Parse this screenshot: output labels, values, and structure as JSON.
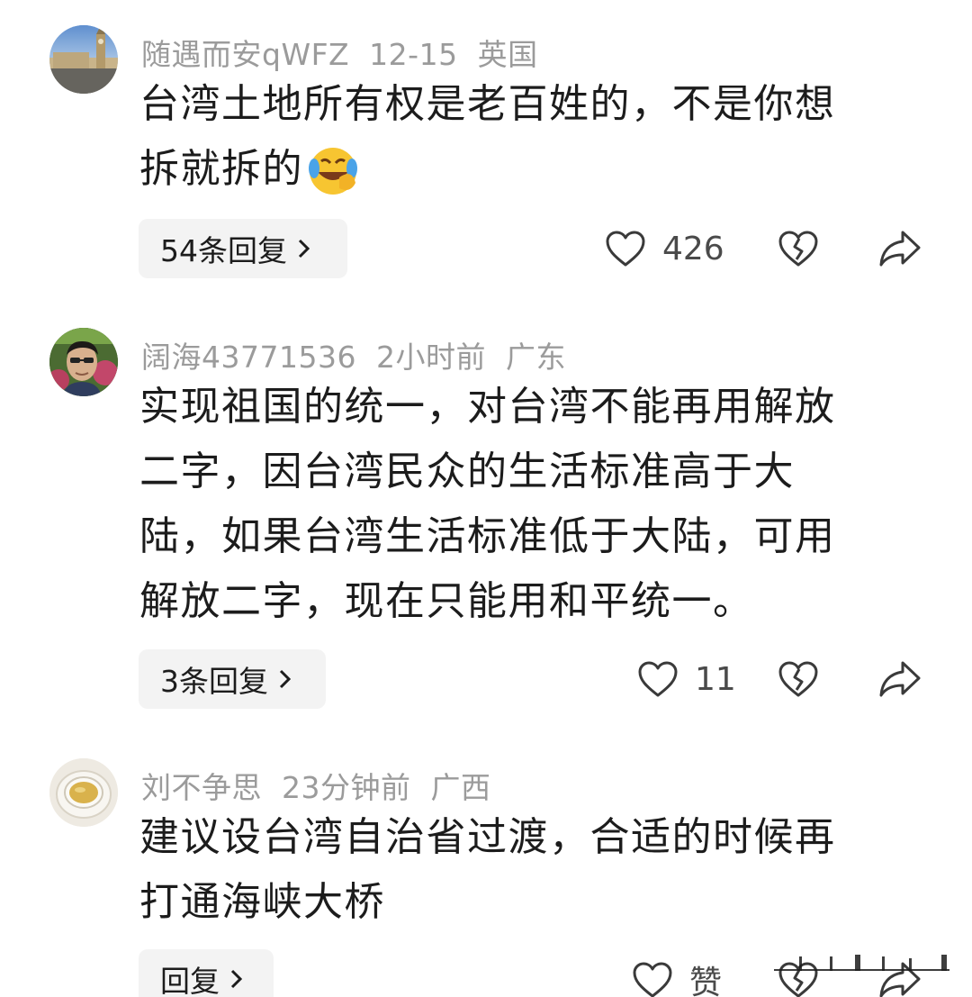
{
  "comments": [
    {
      "username": "随遇而安qWFZ",
      "time": "12-15",
      "region": "英国",
      "lines": [
        "台湾土地所有权是老百姓的，不是你想",
        "拆就拆的"
      ],
      "emoji": "😂",
      "replies_label": "54条回复",
      "likes": "426",
      "avatar_icon": "big-ben-avatar"
    },
    {
      "username": "阔海43771536",
      "time": "2小时前",
      "region": "广东",
      "lines": [
        "实现祖国的统一，对台湾不能再用解放",
        "二字，因台湾民众的生活标准高于大",
        "陆，如果台湾生活标准低于大陆，可用",
        "解放二字，现在只能用和平统一。"
      ],
      "replies_label": "3条回复",
      "likes": "11",
      "avatar_icon": "man-portrait-avatar"
    },
    {
      "username": "刘不争思",
      "time": "23分钟前",
      "region": "广西",
      "lines": [
        "建议设台湾自治省过渡，合适的时候再",
        "打通海峡大桥"
      ],
      "replies_label": "回复",
      "likes": "赞",
      "avatar_icon": "tea-cup-avatar"
    }
  ],
  "colors": {
    "meta": "#9b9b9b",
    "text": "#1c1c1c",
    "pill_bg": "#f3f3f3",
    "icon": "#3a3a3a"
  },
  "icons": [
    "heart-icon",
    "broken-heart-icon",
    "share-arrow-icon",
    "chevron-right-icon"
  ]
}
